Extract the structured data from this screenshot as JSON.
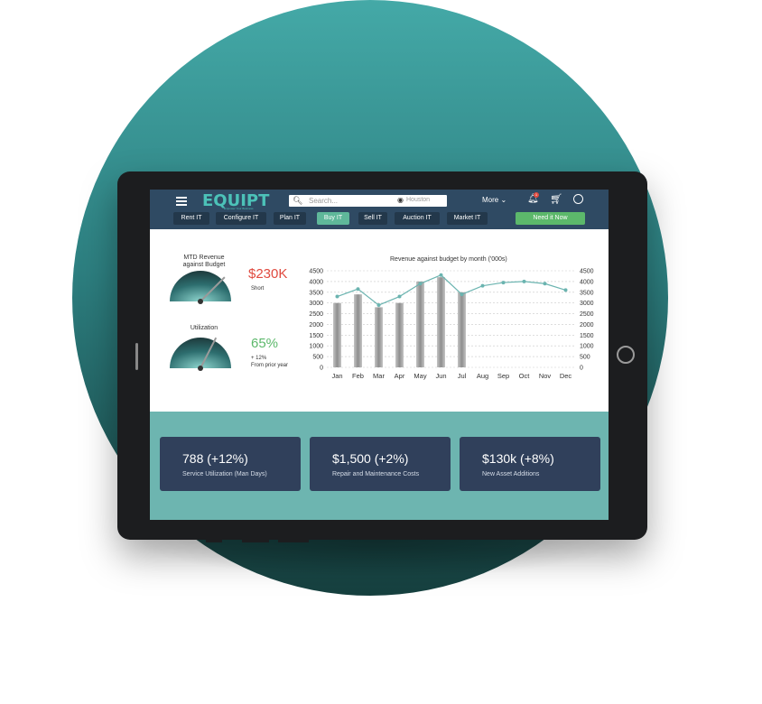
{
  "brand": {
    "logo": "EQUIPT",
    "tagline": "Empower Your Business"
  },
  "search": {
    "placeholder": "Search...",
    "location": "Houston"
  },
  "header": {
    "more_label": "More ⌄",
    "notification_count": "1"
  },
  "nav_tabs": [
    {
      "label": "Rent IT",
      "active": false
    },
    {
      "label": "Configure IT",
      "active": false
    },
    {
      "label": "Plan IT",
      "active": false
    },
    {
      "label": "Buy IT",
      "active": true
    },
    {
      "label": "Sell IT",
      "active": false
    },
    {
      "label": "Auction IT",
      "active": false
    },
    {
      "label": "Market IT",
      "active": false
    }
  ],
  "cta": {
    "label": "Need it Now"
  },
  "kpis": {
    "mtd": {
      "label_line1": "MTD Revenue",
      "label_line2": "against Budget",
      "value": "$230K",
      "note": "Short",
      "color": "#e04a3f",
      "gauge_fraction": 0.75
    },
    "utilization": {
      "label": "Utilization",
      "value": "65%",
      "note_line1": "+ 12%",
      "note_line2": "From prior year",
      "color": "#5cb86b",
      "gauge_fraction": 0.65
    }
  },
  "chart_data": {
    "type": "bar",
    "title": "Revenue against budget by month ('000s)",
    "categories": [
      "Jan",
      "Feb",
      "Mar",
      "Apr",
      "May",
      "Jun",
      "Jul",
      "Aug",
      "Sep",
      "Oct",
      "Nov",
      "Dec"
    ],
    "series": [
      {
        "type": "bar",
        "values": [
          3000,
          3400,
          2800,
          3000,
          4000,
          4200,
          3500,
          null,
          null,
          null,
          null,
          null
        ]
      },
      {
        "type": "line",
        "values": [
          3300,
          3650,
          2900,
          3300,
          3900,
          4300,
          3400,
          3800,
          3950,
          4000,
          3900,
          3600
        ]
      }
    ],
    "ylim": [
      0,
      4500
    ],
    "yticks": [
      0,
      500,
      1000,
      1500,
      2000,
      2500,
      3000,
      3500,
      4000,
      4500
    ],
    "grid": true,
    "colors": {
      "bar": "#9a9a9a",
      "line": "#6bb4b0"
    }
  },
  "cards": [
    {
      "value": "788 (+12%)",
      "label": "Service Utilization (Man Days)"
    },
    {
      "value": "$1,500 (+2%)",
      "label": "Repair and Maintenance Costs"
    },
    {
      "value": "$130k (+8%)",
      "label": "New Asset Additions"
    }
  ],
  "colors": {
    "topbar": "#2f4a63",
    "accent": "#4cc2b8",
    "bottom_band": "#6db5b0",
    "card": "#30405b"
  }
}
